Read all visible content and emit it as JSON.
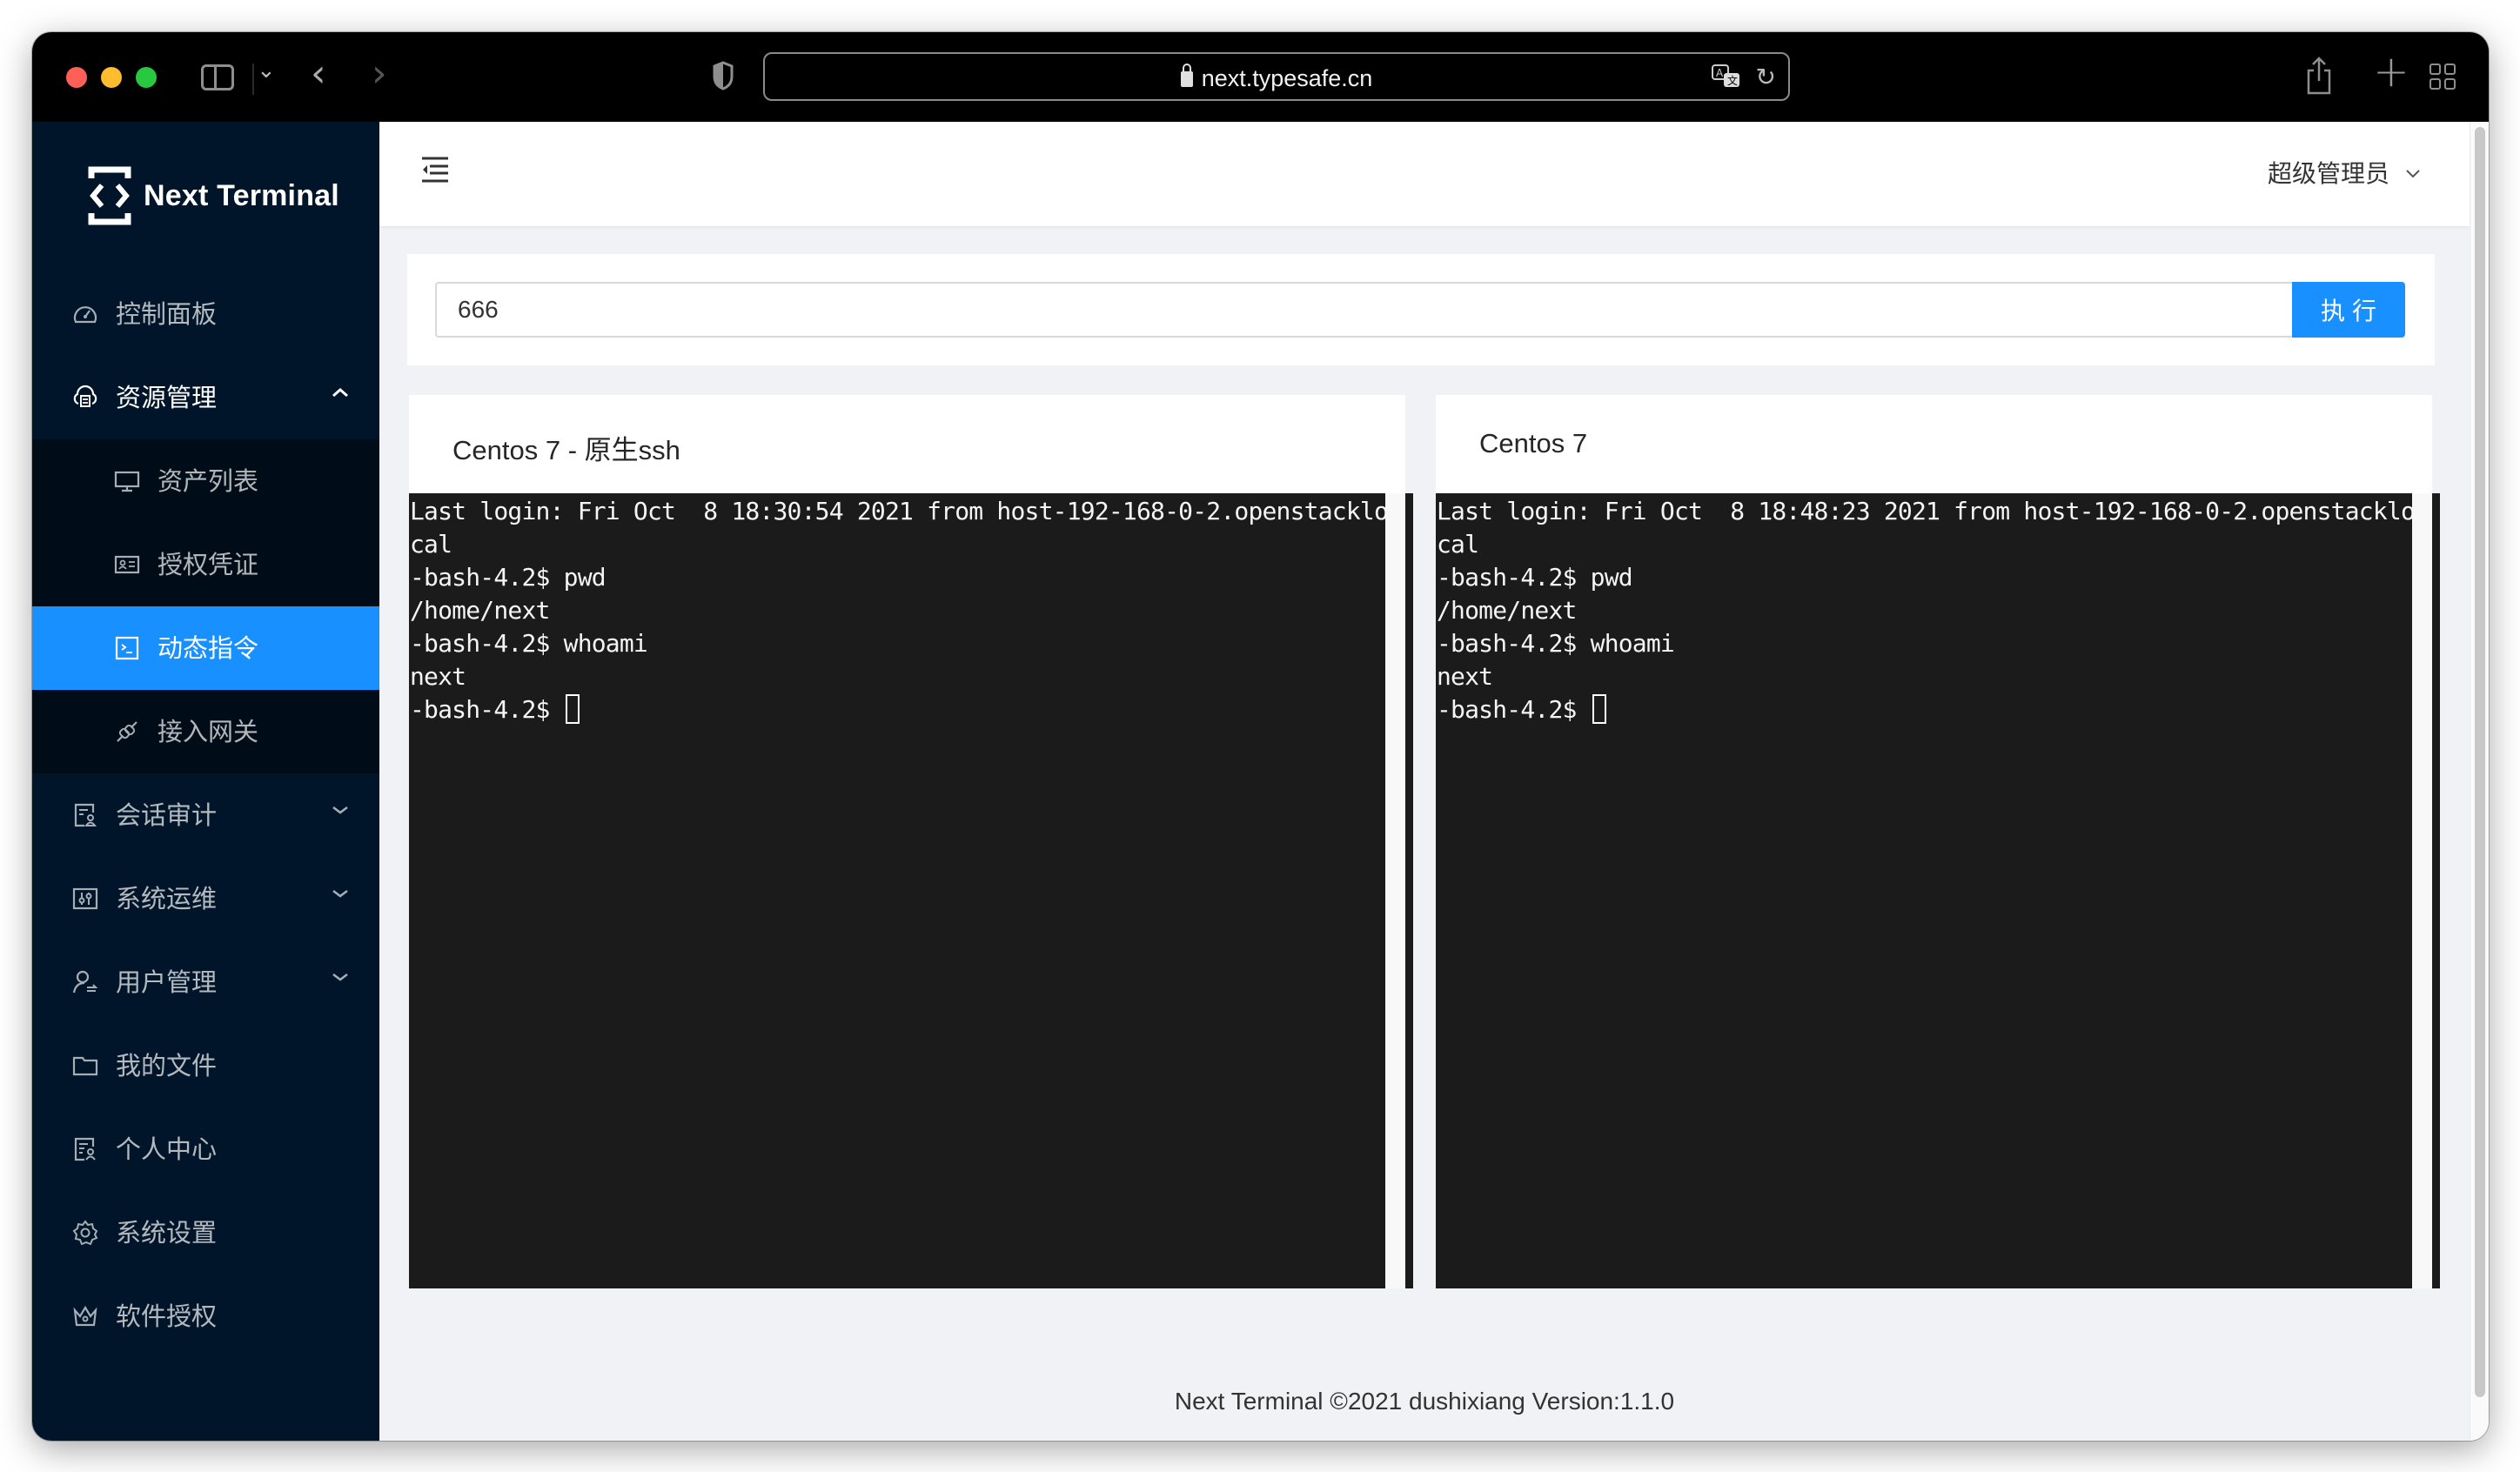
{
  "browser": {
    "url": "next.typesafe.cn",
    "icons": [
      "sidebar-toggle-icon",
      "chevron-down-icon",
      "back-icon",
      "forward-icon",
      "shield-icon",
      "lock-icon",
      "translate-icon",
      "reload-icon",
      "share-icon",
      "new-tab-icon",
      "tab-overview-icon"
    ],
    "back_glyph": "‹",
    "forward_glyph": "›",
    "chevron_glyph": "⌄",
    "reload_glyph": "↻",
    "plus_glyph": "+"
  },
  "app": {
    "name": "Next Terminal",
    "accent_color": "#1890ff",
    "sidebar_bg": "#001529"
  },
  "sidebar": {
    "items": [
      {
        "label": "控制面板",
        "icon": "dashboard-icon"
      },
      {
        "label": "资源管理",
        "icon": "cloud-server-icon",
        "expanded": true,
        "children": [
          {
            "label": "资产列表",
            "icon": "desktop-icon"
          },
          {
            "label": "授权凭证",
            "icon": "id-card-icon"
          },
          {
            "label": "动态指令",
            "icon": "code-icon",
            "active": true
          },
          {
            "label": "接入网关",
            "icon": "api-icon"
          }
        ]
      },
      {
        "label": "会话审计",
        "icon": "audit-icon",
        "expandable": true
      },
      {
        "label": "系统运维",
        "icon": "control-icon",
        "expandable": true
      },
      {
        "label": "用户管理",
        "icon": "user-switch-icon",
        "expandable": true
      },
      {
        "label": "我的文件",
        "icon": "folder-icon"
      },
      {
        "label": "个人中心",
        "icon": "profile-icon"
      },
      {
        "label": "系统设置",
        "icon": "setting-icon"
      },
      {
        "label": "软件授权",
        "icon": "crown-icon"
      }
    ],
    "arrow_up": "⌃",
    "arrow_down": "⌄"
  },
  "header": {
    "user": "超级管理员",
    "caret": "∨"
  },
  "command": {
    "value": "666",
    "placeholder": "",
    "execute_label": "执行"
  },
  "terminals": [
    {
      "title": "Centos 7 - 原生ssh",
      "lines": [
        "Last login: Fri Oct  8 18:30:54 2021 from host-192-168-0-2.openstacklo",
        "cal",
        "-bash-4.2$ pwd",
        "/home/next",
        "-bash-4.2$ whoami",
        "next"
      ],
      "prompt": "-bash-4.2$ "
    },
    {
      "title": "Centos 7",
      "lines": [
        "Last login: Fri Oct  8 18:48:23 2021 from host-192-168-0-2.openstacklo",
        "cal",
        "-bash-4.2$ pwd",
        "/home/next",
        "-bash-4.2$ whoami",
        "next"
      ],
      "prompt": "-bash-4.2$ "
    }
  ],
  "footer": {
    "text": "Next Terminal ©2021 dushixiang Version:1.1.0"
  }
}
